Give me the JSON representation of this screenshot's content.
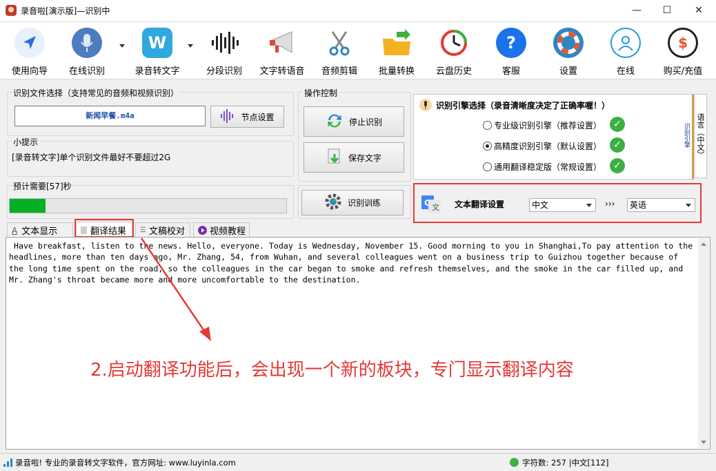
{
  "window": {
    "title": "录音啦[演示版]—识别中",
    "minimize": "—",
    "maximize": "☐",
    "close": "✕"
  },
  "toolbar": {
    "items": [
      {
        "label": "使用向导",
        "icon": "navigation-arrow-icon",
        "color": "#2b6fd6"
      },
      {
        "label": "在线识别",
        "icon": "microphone-icon",
        "color": "#4b7dbf"
      },
      {
        "label": "录音转文字",
        "icon": "w-letter-icon",
        "color": "#2fa8e0"
      },
      {
        "label": "分段识别",
        "icon": "waveform-icon",
        "color": "#222222"
      },
      {
        "label": "文字转语音",
        "icon": "megaphone-icon",
        "color": "#d94a38"
      },
      {
        "label": "音频剪辑",
        "icon": "scissors-icon",
        "color": "#2e86c1"
      },
      {
        "label": "批量转换",
        "icon": "folder-arrow-icon",
        "color": "#f4b223"
      },
      {
        "label": "云盘历史",
        "icon": "clock-history-icon",
        "color": "#e23b2f"
      },
      {
        "label": "客服",
        "icon": "question-icon",
        "color": "#1a73e8"
      },
      {
        "label": "设置",
        "icon": "lifebuoy-icon",
        "color": "#e8552f"
      },
      {
        "label": "在线",
        "icon": "user-icon",
        "color": "#1e9be0"
      },
      {
        "label": "购买/充值",
        "icon": "dollar-coin-icon",
        "color": "#222222"
      }
    ]
  },
  "file_select": {
    "legend": "识别文件选择（支持常见的音频和视频识别）",
    "file_name": "新闻早餐.m4a",
    "node_button": "节点设置"
  },
  "hint": {
    "legend": "小提示",
    "text": "[录音转文字]单个识别文件最好不要超过2G"
  },
  "progress": {
    "legend": "预计需要[57]秒",
    "fraction": 0.13
  },
  "operations": {
    "legend": "操作控制",
    "stop": "停止识别",
    "save": "保存文字",
    "train": "识别训练"
  },
  "engine": {
    "title": "识别引擎选择（录音清晰度决定了正确率喔！）",
    "options": [
      {
        "label": "专业级识别引擎（推荐设置）",
        "checked": false
      },
      {
        "label": "高精度识别引擎（默认设置）",
        "checked": true
      },
      {
        "label": "通用翻译稳定版（常规设置）",
        "checked": false
      }
    ],
    "side_tab_language": "语言（中文）",
    "side_tab_engine": "识别引擎"
  },
  "translation": {
    "label": "文本翻译设置",
    "source": "中文",
    "arrows": "›››",
    "target": "英语"
  },
  "tabs": [
    {
      "label": "文本显示",
      "active": false
    },
    {
      "label": "翻译结果",
      "active": true
    },
    {
      "label": "文稿校对",
      "active": false
    },
    {
      "label": "视频教程",
      "active": false
    }
  ],
  "content": {
    "text": " Have breakfast, listen to the news. Hello, everyone. Today is Wednesday, November 15. Good morning to you in Shanghai,To pay attention to the headlines, more than ten days ago, Mr. Zhang, 54, from Wuhan, and several colleagues went on a business trip to Guizhou together because of the long time spent on the road, so the colleagues in the car began to smoke and refresh themselves, and the smoke in the car filled up, and Mr. Zhang's throat became more and more uncomfortable to the destination."
  },
  "annotation": {
    "text": "2.启动翻译功能后，会出现一个新的板块，专门显示翻译内容",
    "color": "#e53935"
  },
  "status": {
    "left": "录音啦! 专业的录音转文字软件，官方网址: www.luyinla.com",
    "right": "字符数: 257 |中文[112]"
  }
}
